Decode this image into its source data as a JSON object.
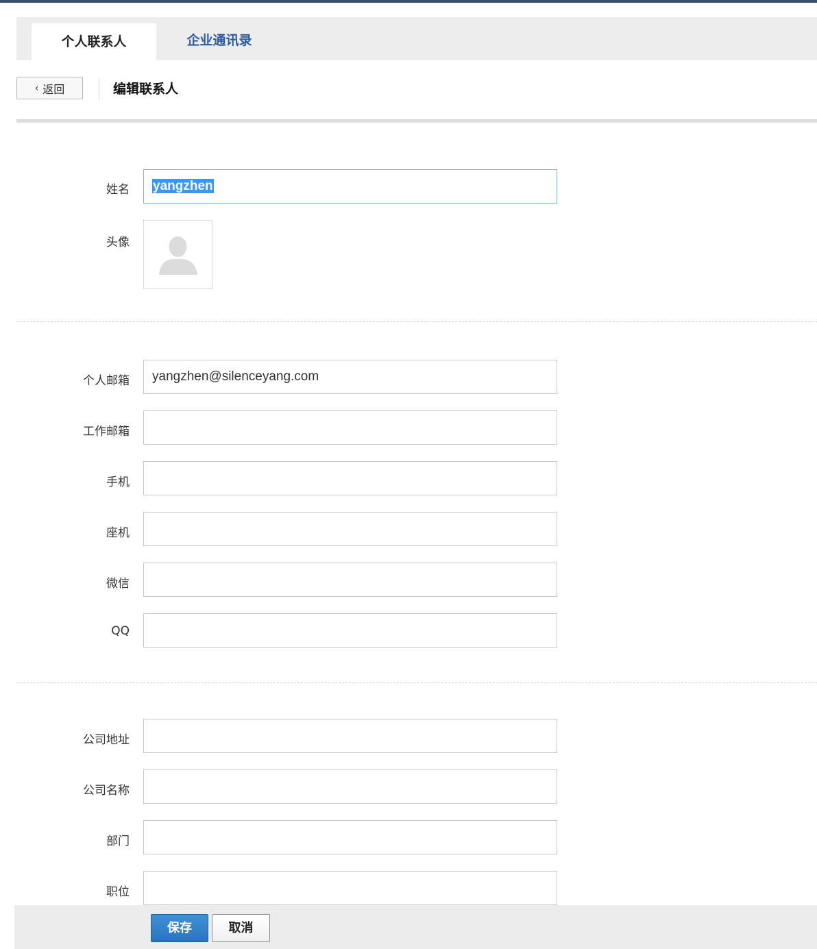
{
  "tabs": [
    {
      "label": "个人联系人",
      "active": true
    },
    {
      "label": "企业通讯录",
      "active": false
    }
  ],
  "toolbar": {
    "back_label": "返回",
    "title": "编辑联系人"
  },
  "form": {
    "name": {
      "label": "姓名",
      "value": "yangzhen"
    },
    "avatar": {
      "label": "头像",
      "icon": "person-silhouette-icon"
    },
    "personal_email": {
      "label": "个人邮箱",
      "value": "yangzhen@silenceyang.com"
    },
    "work_email": {
      "label": "工作邮箱",
      "value": ""
    },
    "mobile": {
      "label": "手机",
      "value": ""
    },
    "landline": {
      "label": "座机",
      "value": ""
    },
    "wechat": {
      "label": "微信",
      "value": ""
    },
    "qq": {
      "label": "QQ",
      "value": ""
    },
    "company_address": {
      "label": "公司地址",
      "value": ""
    },
    "company_name": {
      "label": "公司名称",
      "value": ""
    },
    "department": {
      "label": "部门",
      "value": ""
    },
    "position": {
      "label": "职位",
      "value": ""
    }
  },
  "footer": {
    "save_label": "保存",
    "cancel_label": "取消"
  },
  "colors": {
    "accent": "#2a74bf",
    "link": "#2c5ba8",
    "selection": "#3399ff"
  }
}
